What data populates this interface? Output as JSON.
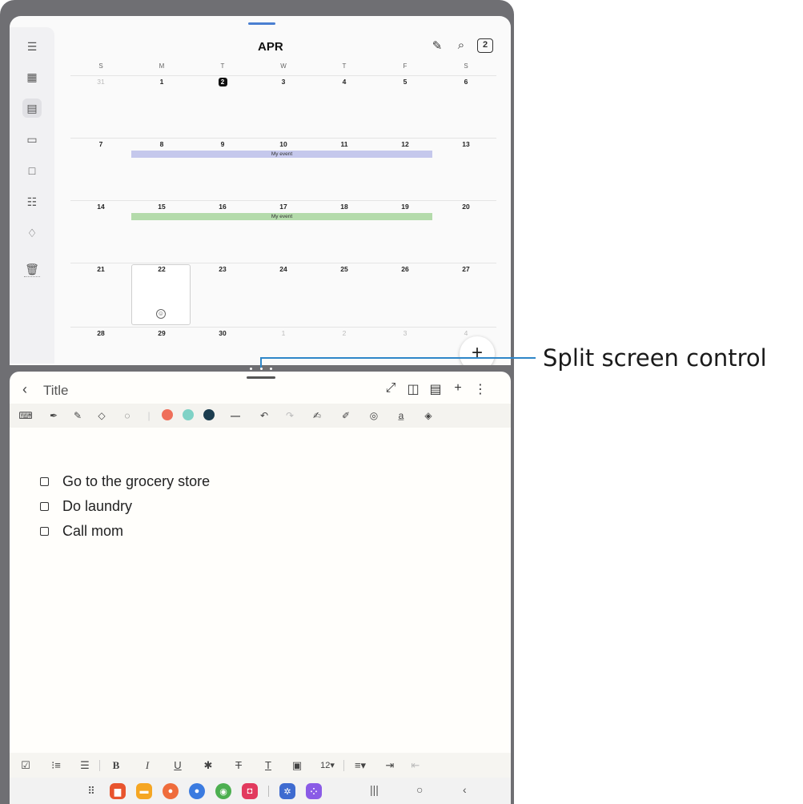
{
  "calendar": {
    "month": "APR",
    "weekday_headers": [
      "S",
      "M",
      "T",
      "W",
      "T",
      "F",
      "S"
    ],
    "weeks": [
      [
        "31",
        "1",
        "2",
        "3",
        "4",
        "5",
        "6"
      ],
      [
        "7",
        "8",
        "9",
        "10",
        "11",
        "12",
        "13"
      ],
      [
        "14",
        "15",
        "16",
        "17",
        "18",
        "19",
        "20"
      ],
      [
        "21",
        "22",
        "23",
        "24",
        "25",
        "26",
        "27"
      ],
      [
        "28",
        "29",
        "30",
        "1",
        "2",
        "3",
        "4"
      ]
    ],
    "today": "2",
    "events": [
      {
        "label": "My event",
        "color": "#c5c8ec"
      },
      {
        "label": "My event",
        "color": "#b4dbab"
      }
    ],
    "count_badge": "2",
    "fab_label": "+",
    "sidebar_icons": [
      "menu-icon",
      "year-view-icon",
      "month-view-icon",
      "week-view-icon",
      "day-view-icon",
      "list-view-icon",
      "reminder-icon",
      "trash-icon"
    ]
  },
  "split_control_label": "Split screen control",
  "notes": {
    "title_placeholder": "Title",
    "pen_colors": [
      "#ef6f5a",
      "#7fd2c6",
      "#1c3d4f"
    ],
    "checklist": [
      "Go to the grocery store",
      "Do laundry",
      "Call mom"
    ],
    "font_size": "12"
  },
  "colors": {
    "accent": "#2e86c8",
    "frame": "#6f6f73"
  }
}
